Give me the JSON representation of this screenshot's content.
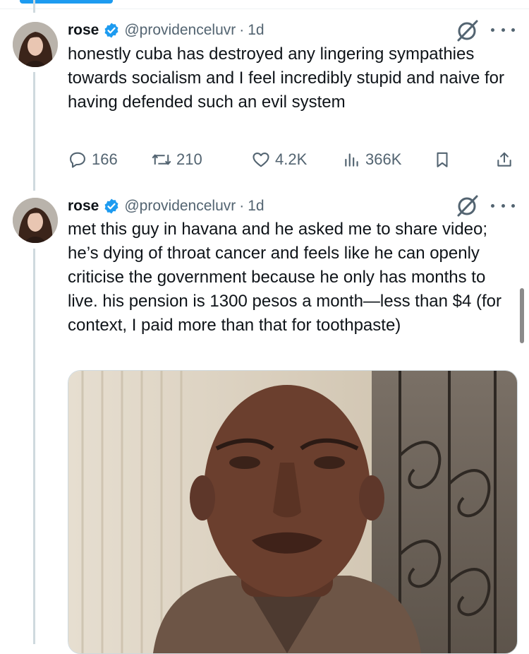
{
  "tweets": [
    {
      "name": "rose",
      "handle": "@providenceluvr",
      "separator": "·",
      "time": "1d",
      "text": "honestly cuba has destroyed any lingering sympathies towards socialism and I feel incredibly stupid and naive for having defended such an evil system",
      "stats": {
        "replies": "166",
        "reposts": "210",
        "likes": "4.2K",
        "views": "366K"
      }
    },
    {
      "name": "rose",
      "handle": "@providenceluvr",
      "separator": "·",
      "time": "1d",
      "text": "met this guy in havana and he asked me to share video; he’s dying of throat cancer and feels like he can openly criticise the government because he only has months to live. his pension is 1300 pesos a month—less than $4 (for context, I paid more than that for toothpaste)"
    }
  ],
  "colors": {
    "accent": "#1d9bf0",
    "text": "#0f1419",
    "secondary": "#536471",
    "thread_line": "#cfd9de"
  },
  "icons": {
    "verified": "verified-badge-icon",
    "grok": "grok-icon",
    "more": "more-dots-icon",
    "reply": "reply-icon",
    "repost": "repost-icon",
    "like": "heart-icon",
    "views": "views-chart-icon",
    "bookmark": "bookmark-icon",
    "share": "share-icon"
  }
}
